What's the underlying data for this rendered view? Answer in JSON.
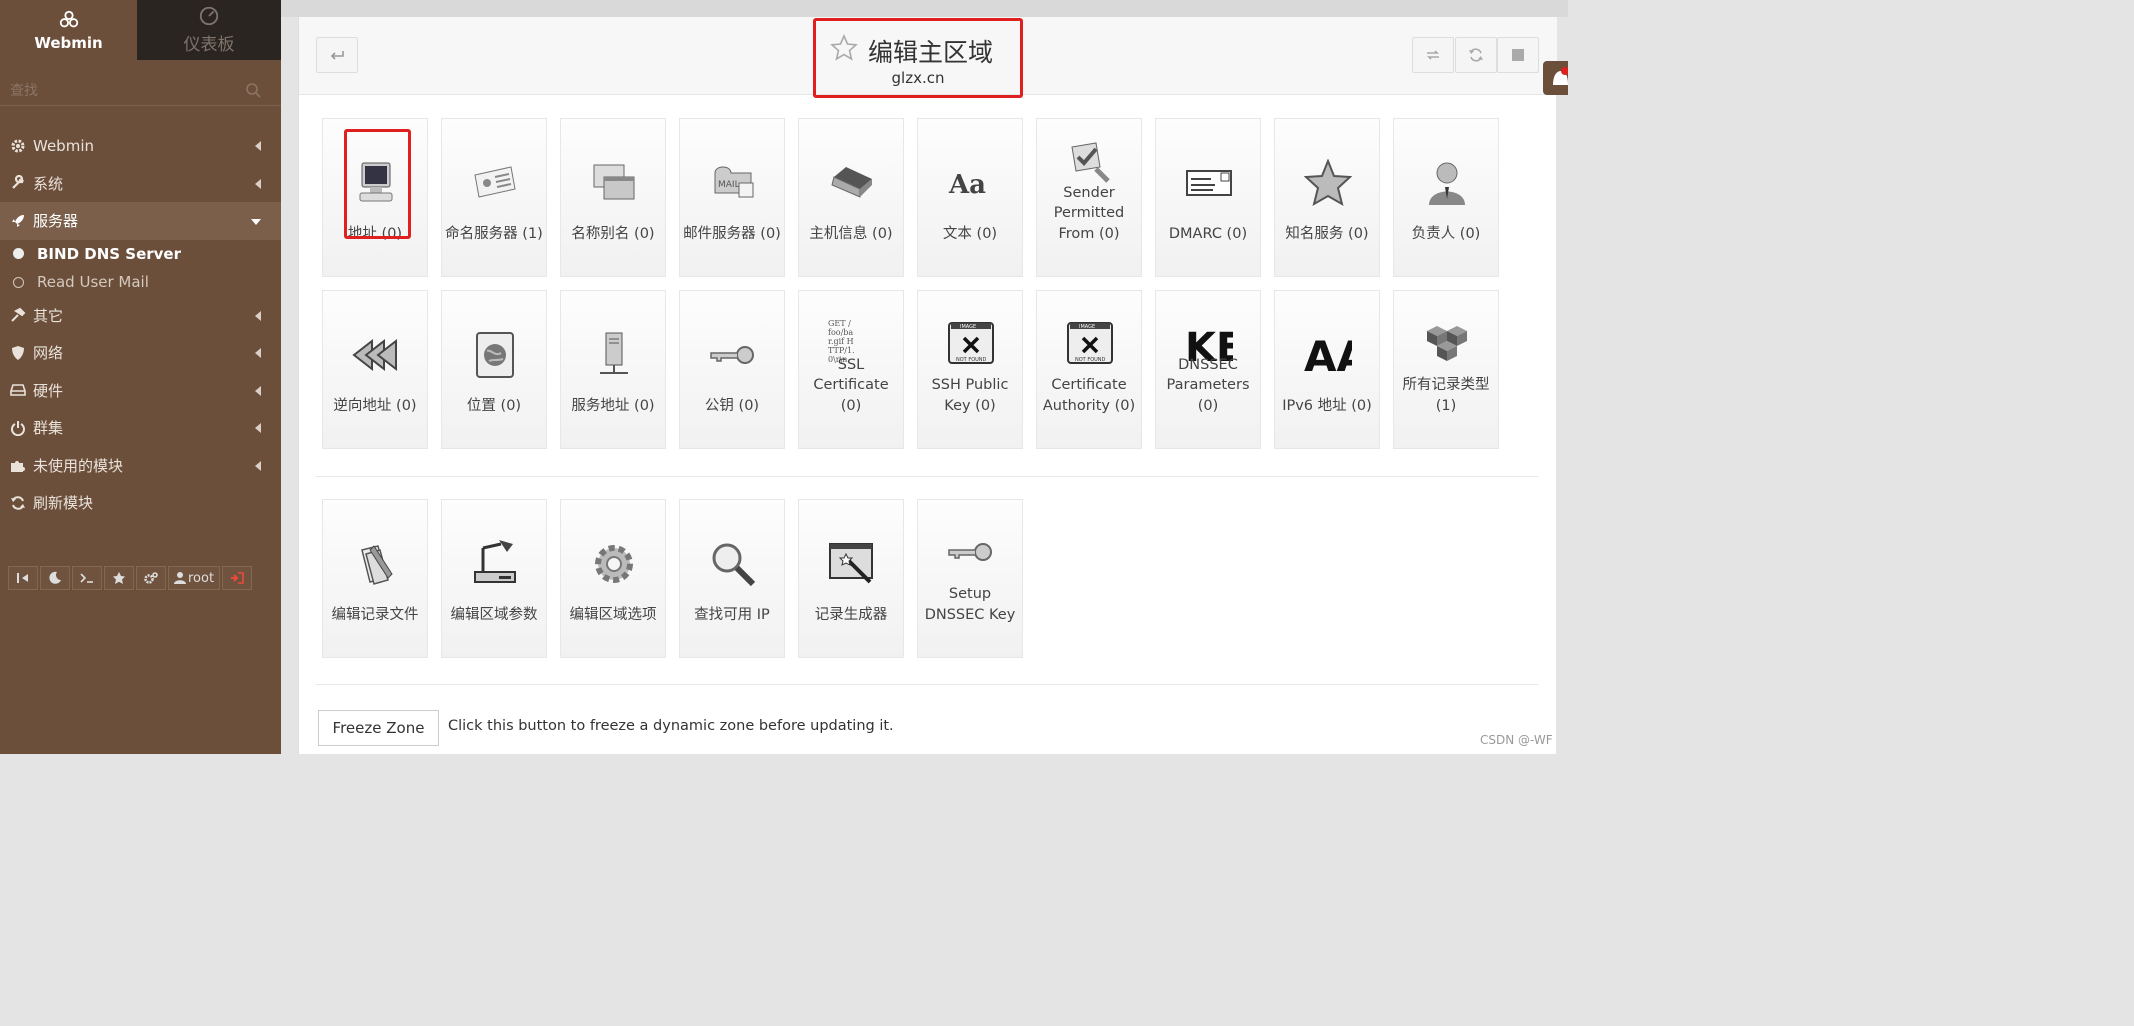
{
  "sidebar": {
    "tab_webmin": "Webmin",
    "tab_dashboard": "仪表板",
    "search_placeholder": "查找",
    "menu": [
      {
        "label": "Webmin",
        "icon": "gear-icon"
      },
      {
        "label": "系统",
        "icon": "wrench-icon"
      },
      {
        "label": "服务器",
        "icon": "rocket-icon",
        "expanded": true
      },
      {
        "label": "其它",
        "icon": "hammer-icon"
      },
      {
        "label": "网络",
        "icon": "shield-icon"
      },
      {
        "label": "硬件",
        "icon": "hdd-icon"
      },
      {
        "label": "群集",
        "icon": "power-icon"
      },
      {
        "label": "未使用的模块",
        "icon": "puzzle-icon"
      },
      {
        "label": "刷新模块",
        "icon": "refresh-icon"
      }
    ],
    "server_items": [
      {
        "label": "BIND DNS Server",
        "active": true
      },
      {
        "label": "Read User Mail",
        "active": false
      }
    ],
    "user": "root"
  },
  "header": {
    "title": "编辑主区域",
    "subtitle": "glzx.cn"
  },
  "record_types_row1": [
    {
      "label": "地址 (0)",
      "icon": "computer-icon"
    },
    {
      "label": "命名服务器 (1)",
      "icon": "id-card-icon"
    },
    {
      "label": "名称别名 (0)",
      "icon": "windows-icon"
    },
    {
      "label": "邮件服务器 (0)",
      "icon": "mailbox-icon"
    },
    {
      "label": "主机信息 (0)",
      "icon": "laptop-icon"
    },
    {
      "label": "文本 (0)",
      "icon": "font-icon"
    },
    {
      "label": "Sender Permitted From (0)",
      "icon": "shield-check-icon"
    },
    {
      "label": "DMARC (0)",
      "icon": "email-card-icon"
    },
    {
      "label": "知名服务 (0)",
      "icon": "star-icon"
    },
    {
      "label": "负责人 (0)",
      "icon": "person-icon"
    }
  ],
  "record_types_row2": [
    {
      "label": "逆向地址 (0)",
      "icon": "rewind-icon"
    },
    {
      "label": "位置 (0)",
      "icon": "globe-icon"
    },
    {
      "label": "服务地址 (0)",
      "icon": "server-icon"
    },
    {
      "label": "公钥 (0)",
      "icon": "key-icon"
    },
    {
      "label": "SSL Certificate (0)",
      "icon": "certificate-icon"
    },
    {
      "label": "SSH Public Key (0)",
      "icon": "image-not-found-icon"
    },
    {
      "label": "Certificate Authority (0)",
      "icon": "image-not-found-icon"
    },
    {
      "label": "DNSSEC Parameters (0)",
      "icon": "ke-text-icon"
    },
    {
      "label": "IPv6 地址 (0)",
      "icon": "aa-text-icon"
    },
    {
      "label": "所有记录类型 (1)",
      "icon": "cubes-icon"
    }
  ],
  "image_not_found": {
    "top": "IMAGE",
    "bottom": "NOT FOUND"
  },
  "glyph_text": {
    "font": "Aa",
    "dnssec": "KE",
    "ipv6": "AA",
    "cert": [
      "GET /",
      "foo/ba",
      "r.gif H",
      "TTP/1.",
      "0\\r\\n"
    ]
  },
  "zone_tools": [
    {
      "label": "编辑记录文件",
      "icon": "edit-file-icon"
    },
    {
      "label": "编辑区域参数",
      "icon": "lamp-icon"
    },
    {
      "label": "编辑区域选项",
      "icon": "cog-icon"
    },
    {
      "label": "查找可用 IP",
      "icon": "magnifier-icon"
    },
    {
      "label": "记录生成器",
      "icon": "wizard-icon"
    },
    {
      "label": "Setup DNSSEC Key",
      "icon": "key-icon"
    }
  ],
  "freeze": {
    "button": "Freeze Zone",
    "description": "Click this button to freeze a dynamic zone before updating it."
  },
  "watermark": "CSDN @-WF",
  "colors": {
    "sidebar": "#6b4f3b",
    "highlight": "#e0201f",
    "dashboard_tab": "#2b2521"
  }
}
